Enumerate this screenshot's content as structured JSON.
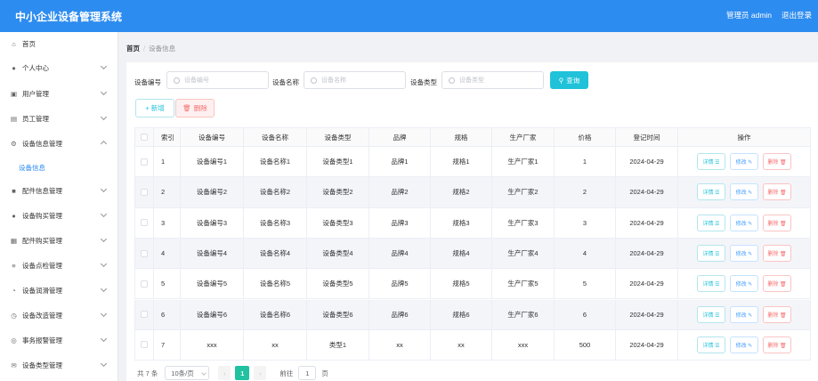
{
  "header": {
    "title": "中小企业设备管理系统",
    "user": "管理员 admin",
    "logout": "退出登录"
  },
  "sidebar": {
    "items": [
      {
        "label": "首页",
        "icon": "home-icon",
        "has_arrow": false
      },
      {
        "label": "个人中心",
        "icon": "user-icon",
        "has_arrow": true
      },
      {
        "label": "用户管理",
        "icon": "users-icon",
        "has_arrow": true
      },
      {
        "label": "员工管理",
        "icon": "id-card-icon",
        "has_arrow": true
      },
      {
        "label": "设备信息管理",
        "icon": "settings-icon",
        "has_arrow": true,
        "expanded": true
      },
      {
        "label": "配件信息管理",
        "icon": "box-icon",
        "has_arrow": true
      },
      {
        "label": "设备购买管理",
        "icon": "user-icon",
        "has_arrow": true
      },
      {
        "label": "配件购买管理",
        "icon": "printer-icon",
        "has_arrow": true
      },
      {
        "label": "设备点检管理",
        "icon": "list-icon",
        "has_arrow": true
      },
      {
        "label": "设备润滑管理",
        "icon": "gauge-icon",
        "has_arrow": true
      },
      {
        "label": "设备改造管理",
        "icon": "clock-icon",
        "has_arrow": true
      },
      {
        "label": "事务报警管理",
        "icon": "alarm-icon",
        "has_arrow": true
      },
      {
        "label": "设备类型管理",
        "icon": "mail-icon",
        "has_arrow": true
      }
    ],
    "subitem": "设备信息"
  },
  "breadcrumb": {
    "home": "首页",
    "sep": "/",
    "current": "设备信息"
  },
  "search": {
    "fields": [
      {
        "label": "设备编号",
        "placeholder": "设备编号"
      },
      {
        "label": "设备名称",
        "placeholder": "设备名称"
      },
      {
        "label": "设备类型",
        "placeholder": "设备类型"
      }
    ],
    "query_label": "查询"
  },
  "actions": {
    "add_label": "+ 新增",
    "delete_label": "删除"
  },
  "table": {
    "columns": [
      "索引",
      "设备编号",
      "设备名称",
      "设备类型",
      "品牌",
      "规格",
      "生产厂家",
      "价格",
      "登记时间",
      "操作"
    ],
    "rows": [
      [
        "1",
        "设备编号1",
        "设备名称1",
        "设备类型1",
        "品牌1",
        "规格1",
        "生产厂家1",
        "1",
        "2024-04-29"
      ],
      [
        "2",
        "设备编号2",
        "设备名称2",
        "设备类型2",
        "品牌2",
        "规格2",
        "生产厂家2",
        "2",
        "2024-04-29"
      ],
      [
        "3",
        "设备编号3",
        "设备名称3",
        "设备类型3",
        "品牌3",
        "规格3",
        "生产厂家3",
        "3",
        "2024-04-29"
      ],
      [
        "4",
        "设备编号4",
        "设备名称4",
        "设备类型4",
        "品牌4",
        "规格4",
        "生产厂家4",
        "4",
        "2024-04-29"
      ],
      [
        "5",
        "设备编号5",
        "设备名称5",
        "设备类型5",
        "品牌5",
        "规格5",
        "生产厂家5",
        "5",
        "2024-04-29"
      ],
      [
        "6",
        "设备编号6",
        "设备名称6",
        "设备类型6",
        "品牌6",
        "规格6",
        "生产厂家6",
        "6",
        "2024-04-29"
      ],
      [
        "7",
        "xxx",
        "xx",
        "类型1",
        "xx",
        "xx",
        "xxx",
        "500",
        "2024-04-29"
      ]
    ],
    "row_actions": {
      "detail": "详情 ☰",
      "edit": "修改 ✎",
      "remove": "删除 🗑"
    }
  },
  "pager": {
    "total": "共 7 条",
    "page_size": "10条/页",
    "prev": "‹",
    "page": "1",
    "next": "›",
    "goto": "前往",
    "goto_value": "1",
    "page_unit": "页"
  },
  "colors": {
    "header": "#2d8cf0",
    "accent": "#20c2d9",
    "danger": "#f56c6c",
    "page_active": "#20c2a0"
  }
}
